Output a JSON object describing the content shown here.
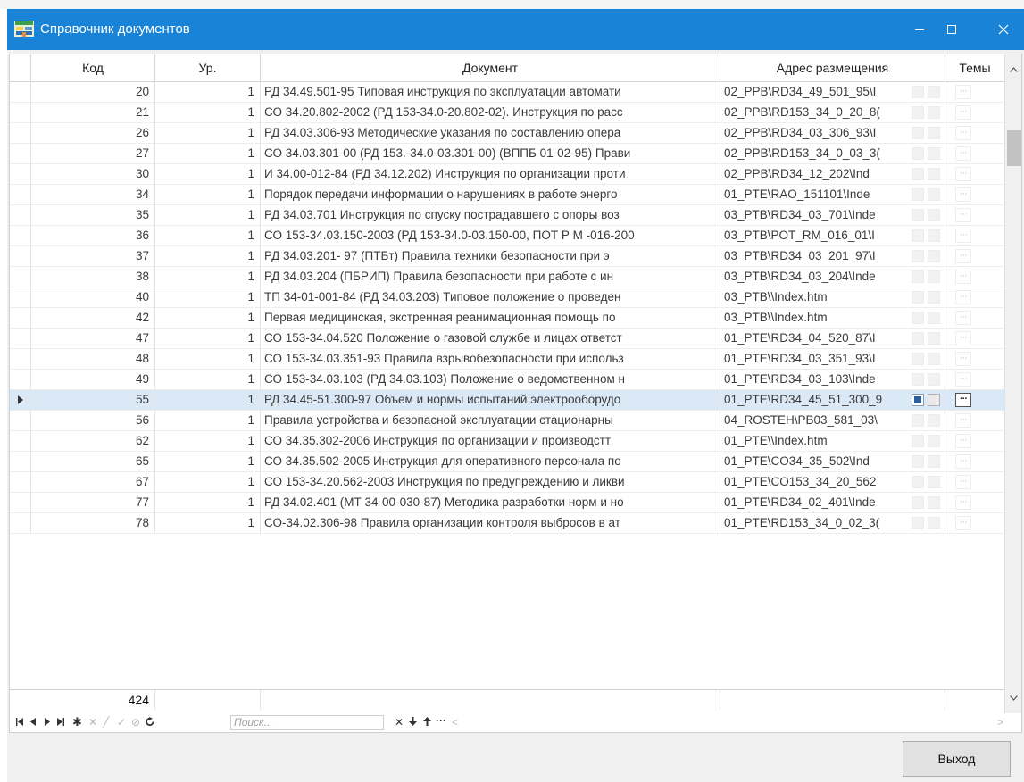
{
  "window": {
    "title": "Справочник документов"
  },
  "table": {
    "columns": [
      "Код",
      "Ур.",
      "Документ",
      "Адрес размещения",
      "Темы"
    ],
    "rows": [
      {
        "kod": "20",
        "ur": "1",
        "doc": "РД 34.49.501-95 Типовая инструкция по эксплуатации автомати",
        "addr": "02_PPB\\RD34_49_501_95\\I"
      },
      {
        "kod": "21",
        "ur": "1",
        "doc": "СО 34.20.802-2002 (РД 153-34.0-20.802-02).  Инструкция по расс",
        "addr": "02_PPB\\RD153_34_0_20_8("
      },
      {
        "kod": "26",
        "ur": "1",
        "doc": "РД 34.03.306-93 Методические указания по составлению опера",
        "addr": "02_PPB\\RD34_03_306_93\\I"
      },
      {
        "kod": "27",
        "ur": "1",
        "doc": "СО 34.03.301-00 (РД 153.-34.0-03.301-00)  (ВППБ 01-02-95) Прави",
        "addr": "02_PPB\\RD153_34_0_03_3("
      },
      {
        "kod": "30",
        "ur": "1",
        "doc": "И 34.00-012-84 (РД 34.12.202) Инструкция по организации проти",
        "addr": "02_PPB\\RD34_12_202\\Ind"
      },
      {
        "kod": "34",
        "ur": "1",
        "doc": "Порядок передачи информации о нарушениях в работе энерго",
        "addr": "01_PTE\\RAO_151101\\Inde"
      },
      {
        "kod": "35",
        "ur": "1",
        "doc": "РД 34.03.701 Инструкция по спуску пострадавшего с опоры воз",
        "addr": "03_PTB\\RD34_03_701\\Inde"
      },
      {
        "kod": "36",
        "ur": "1",
        "doc": "СО 153-34.03.150-2003 (РД 153-34.0-03.150-00, ПОТ Р М -016-200",
        "addr": "03_PTB\\POT_RM_016_01\\I"
      },
      {
        "kod": "37",
        "ur": "1",
        "doc": "РД 34.03.201- 97 (ПТБт)    Правила техники безопасности при э",
        "addr": "03_PTB\\RD34_03_201_97\\I"
      },
      {
        "kod": "38",
        "ur": "1",
        "doc": "РД 34.03.204 (ПБРИП)    Правила безопасности при работе с ин",
        "addr": "03_PTB\\RD34_03_204\\Inde"
      },
      {
        "kod": "40",
        "ur": "1",
        "doc": "ТП 34-01-001-84 (РД 34.03.203)  Типовое положение о проведен",
        "addr": "03_PTB\\\\Index.htm"
      },
      {
        "kod": "42",
        "ur": "1",
        "doc": "Первая медицинская, экстренная реанимационная помощь по",
        "addr": "03_PTB\\\\Index.htm"
      },
      {
        "kod": "47",
        "ur": "1",
        "doc": "СО 153-34.04.520 Положение о газовой службе и лицах ответст",
        "addr": "01_PTE\\RD34_04_520_87\\I"
      },
      {
        "kod": "48",
        "ur": "1",
        "doc": "СО 153-34.03.351-93 Правила взрывобезопасности при использ",
        "addr": "01_PTE\\RD34_03_351_93\\I"
      },
      {
        "kod": "49",
        "ur": "1",
        "doc": "СО 153-34.03.103 (РД 34.03.103) Положение о ведомственном н",
        "addr": "01_PTE\\RD34_03_103\\Inde"
      },
      {
        "kod": "55",
        "ur": "1",
        "doc": "РД 34.45-51.300-97 Объем и нормы испытаний электрооборудо",
        "addr": "01_PTE\\RD34_45_51_300_9",
        "selected": true
      },
      {
        "kod": "56",
        "ur": "1",
        "doc": "Правила устройства и безопасной эксплуатации стационарны",
        "addr": "04_ROSTEH\\PB03_581_03\\"
      },
      {
        "kod": "62",
        "ur": "1",
        "doc": "СО 34.35.302-2006  Инструкция по организации и производстт",
        "addr": "01_PTE\\\\Index.htm"
      },
      {
        "kod": "65",
        "ur": "1",
        "doc": "СО 34.35.502-2005 Инструкция для оперативного персонала по",
        "addr": "01_PTE\\CO34_35_502\\Ind"
      },
      {
        "kod": "67",
        "ur": "1",
        "doc": "СО 153-34.20.562-2003 Инструкция по предупреждению и ликви",
        "addr": "01_PTE\\CO153_34_20_562"
      },
      {
        "kod": "77",
        "ur": "1",
        "doc": "РД 34.02.401 (МТ 34-00-030-87) Методика разработки норм и но",
        "addr": "01_PTE\\RD34_02_401\\Inde"
      },
      {
        "kod": "78",
        "ur": "1",
        "doc": "СО-34.02.306-98 Правила организации контроля выбросов в ат",
        "addr": "01_PTE\\RD153_34_0_02_3("
      }
    ],
    "total": "424",
    "dots_label": "···"
  },
  "navigator": {
    "search_placeholder": "Поиск..."
  },
  "buttons": {
    "exit": "Выход"
  },
  "colors": {
    "titlebar": "#1883d7",
    "selected_row": "#dbe9f7"
  }
}
